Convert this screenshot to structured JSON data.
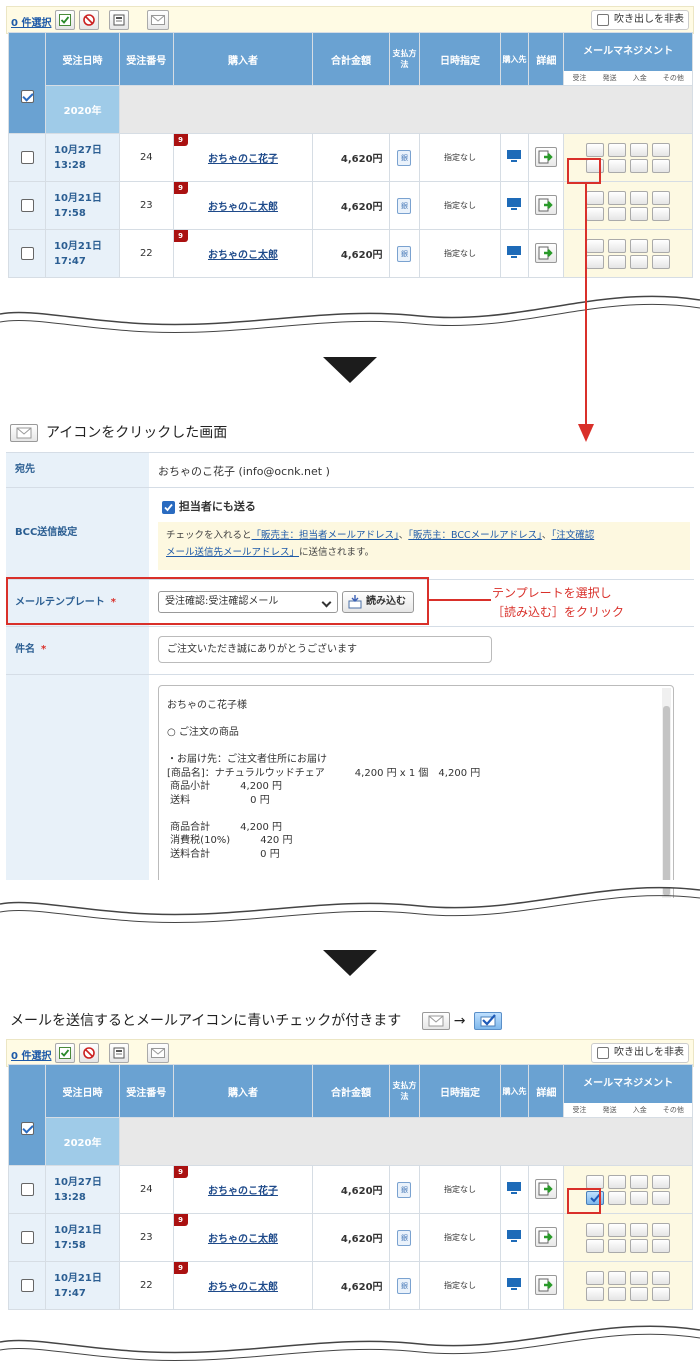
{
  "toolbar": {
    "selected_count": "0 件選択",
    "hide_balloon": "吹き出しを非表示"
  },
  "headers": {
    "date": "受注日時",
    "order_no": "受注番号",
    "buyer": "購入者",
    "total": "合計金額",
    "pay": "支払方法",
    "spec": "日時指定",
    "channel": "購入先",
    "detail": "詳細",
    "mm": "メールマネジメント",
    "mm_sub": [
      "受注",
      "発送",
      "入金",
      "その他"
    ]
  },
  "year_label": "2020年",
  "orders": [
    {
      "date": "10月27日",
      "time": "13:28",
      "no": "24",
      "buyer": "おちゃのこ花子",
      "amount": "4,620円",
      "pay": "銀",
      "spec": "指定なし",
      "badge": "9"
    },
    {
      "date": "10月21日",
      "time": "17:58",
      "no": "23",
      "buyer": "おちゃのこ太郎",
      "amount": "4,620円",
      "pay": "銀",
      "spec": "指定なし",
      "badge": "9"
    },
    {
      "date": "10月21日",
      "time": "17:47",
      "no": "22",
      "buyer": "おちゃのこ太郎",
      "amount": "4,620円",
      "pay": "銀",
      "spec": "指定なし",
      "badge": "9"
    }
  ],
  "middle": {
    "title": "アイコンをクリックした画面",
    "to_label": "宛先",
    "to_value": "おちゃのこ花子 (info@ocnk.net )",
    "bcc_label": "BCC送信設定",
    "bcc_check": "担当者にも送る",
    "bcc_note_1": "チェックを入れると",
    "bcc_link_1": "「販売主：担当者メールアドレス」",
    "bcc_sep_1": "、",
    "bcc_link_2": "「販売主：BCCメールアドレス」",
    "bcc_sep_2": "、",
    "bcc_link_3": "「注文確認",
    "bcc_link_3b": "メール送信先メールアドレス」",
    "bcc_note_2": "に送信されます。",
    "template_label": "メールテンプレート",
    "required": "*",
    "template_value": "受注確認:受注確認メール",
    "load_button": "読み込む",
    "subject_label": "件名",
    "subject_value": "ご注文いただき誠にありがとうございます",
    "body_lines": [
      "おちゃのこ花子様",
      "",
      "○ ご注文の商品",
      "",
      "・お届け先：ご注文者住所にお届け",
      "[商品名]：ナチュラルウッドチェア　　　4,200 円 x 1 個　4,200 円",
      " 商品小計　　　4,200 円",
      " 送料　　　　　　0 円",
      "",
      " 商品合計　　　4,200 円",
      " 消費税(10%)　　　420 円",
      " 送料合計　　　　　0 円"
    ],
    "callout_line1": "テンプレートを選択し",
    "callout_line2": "［読み込む］をクリック"
  },
  "bottom": {
    "caption": "メールを送信するとメールアイコンに青いチェックが付きます",
    "arrow": "→"
  }
}
